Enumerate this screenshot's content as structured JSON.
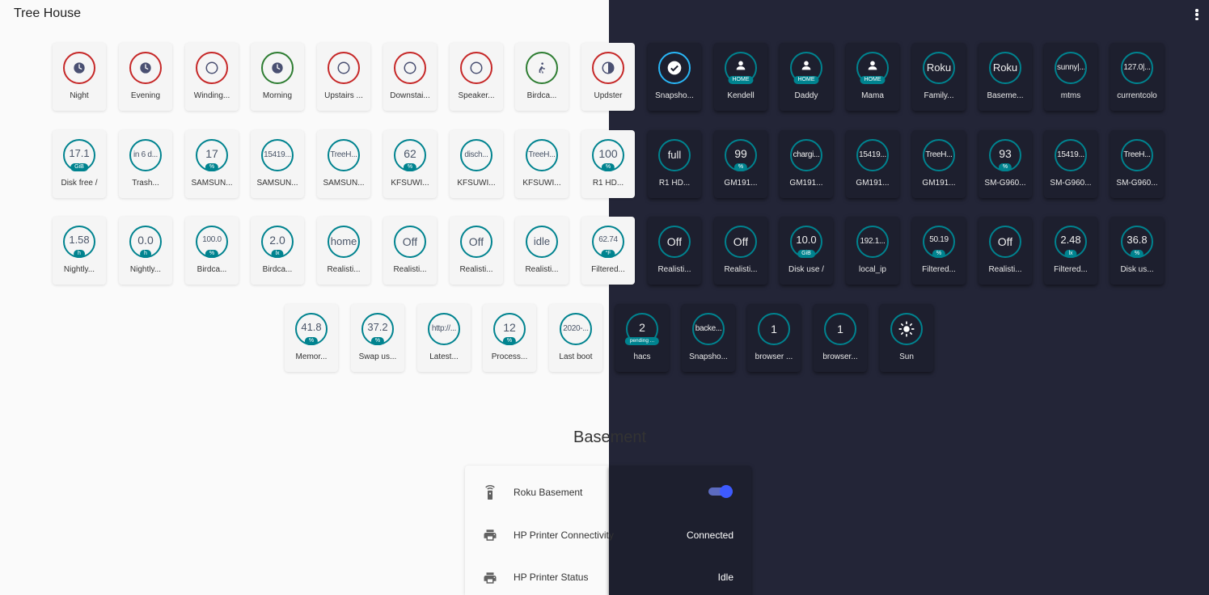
{
  "header": {
    "title": "Tree House",
    "menu_icon": "dots-vertical-icon"
  },
  "badges": [
    {
      "label": "Night",
      "ring": "red",
      "icon": "clock-icon"
    },
    {
      "label": "Evening",
      "ring": "red",
      "icon": "clock-icon"
    },
    {
      "label": "Winding...",
      "ring": "red",
      "icon": "circle-outline-icon"
    },
    {
      "label": "Morning",
      "ring": "green",
      "icon": "clock-icon"
    },
    {
      "label": "Upstairs ...",
      "ring": "red",
      "icon": "circle-outline-icon"
    },
    {
      "label": "Downstai...",
      "ring": "red",
      "icon": "circle-outline-icon"
    },
    {
      "label": "Speaker...",
      "ring": "red",
      "icon": "circle-outline-icon"
    },
    {
      "label": "Birdca...",
      "ring": "green",
      "icon": "walk-icon"
    },
    {
      "label": "Updster",
      "ring": "red",
      "icon": "contrast-circle-icon"
    },
    {
      "label": "Snapsho...",
      "ring": "blue",
      "icon": "check-circle-icon"
    },
    {
      "label": "Kendell",
      "ring": "teal",
      "icon": "person-icon",
      "unit": "HOME"
    },
    {
      "label": "Daddy",
      "ring": "teal",
      "icon": "person-icon",
      "unit": "HOME"
    },
    {
      "label": "Mama",
      "ring": "teal",
      "icon": "person-icon",
      "unit": "HOME"
    },
    {
      "label": "Family...",
      "ring": "teal",
      "value": "Roku"
    },
    {
      "label": "Baseme...",
      "ring": "teal",
      "value": "Roku"
    },
    {
      "label": "mtms",
      "ring": "teal",
      "value": "sunny|..."
    },
    {
      "label": "currentcolo",
      "ring": "teal",
      "value": "127.0|..."
    },
    {
      "label": "Disk free /",
      "ring": "teal",
      "value": "17.1",
      "unit": "GiB"
    },
    {
      "label": "Trash...",
      "ring": "teal",
      "value": "in 6 d..."
    },
    {
      "label": "SAMSUN...",
      "ring": "teal",
      "value": "17",
      "unit": "%"
    },
    {
      "label": "SAMSUN...",
      "ring": "teal",
      "value": "15419..."
    },
    {
      "label": "SAMSUN...",
      "ring": "teal",
      "value": "TreeH..."
    },
    {
      "label": "KFSUWI...",
      "ring": "teal",
      "value": "62",
      "unit": "%"
    },
    {
      "label": "KFSUWI...",
      "ring": "teal",
      "value": "disch..."
    },
    {
      "label": "KFSUWI...",
      "ring": "teal",
      "value": "TreeH..."
    },
    {
      "label": "R1 HD...",
      "ring": "teal",
      "value": "100",
      "unit": "%"
    },
    {
      "label": "R1 HD...",
      "ring": "teal",
      "value": "full"
    },
    {
      "label": "GM191...",
      "ring": "teal",
      "value": "99",
      "unit": "%"
    },
    {
      "label": "GM191...",
      "ring": "teal",
      "value": "chargi..."
    },
    {
      "label": "GM191...",
      "ring": "teal",
      "value": "15419..."
    },
    {
      "label": "GM191...",
      "ring": "teal",
      "value": "TreeH..."
    },
    {
      "label": "SM-G960...",
      "ring": "teal",
      "value": "93",
      "unit": "%"
    },
    {
      "label": "SM-G960...",
      "ring": "teal",
      "value": "15419..."
    },
    {
      "label": "SM-G960...",
      "ring": "teal",
      "value": "TreeH..."
    },
    {
      "label": "Nightly...",
      "ring": "teal",
      "value": "1.58",
      "unit": "h"
    },
    {
      "label": "Nightly...",
      "ring": "teal",
      "value": "0.0",
      "unit": "h"
    },
    {
      "label": "Birdca...",
      "ring": "teal",
      "value": "100.0",
      "unit": "%"
    },
    {
      "label": "Birdca...",
      "ring": "teal",
      "value": "2.0",
      "unit": "lx"
    },
    {
      "label": "Realisti...",
      "ring": "teal",
      "value": "home"
    },
    {
      "label": "Realisti...",
      "ring": "teal",
      "value": "Off"
    },
    {
      "label": "Realisti...",
      "ring": "teal",
      "value": "Off"
    },
    {
      "label": "Realisti...",
      "ring": "teal",
      "value": "idle"
    },
    {
      "label": "Filtered...",
      "ring": "teal",
      "value": "62.74",
      "unit": "°F"
    },
    {
      "label": "Realisti...",
      "ring": "teal",
      "value": "Off"
    },
    {
      "label": "Realisti...",
      "ring": "teal",
      "value": "Off"
    },
    {
      "label": "Disk use /",
      "ring": "teal",
      "value": "10.0",
      "unit": "GiB"
    },
    {
      "label": "local_ip",
      "ring": "teal",
      "value": "192.1..."
    },
    {
      "label": "Filtered...",
      "ring": "teal",
      "value": "50.19",
      "unit": "%"
    },
    {
      "label": "Realisti...",
      "ring": "teal",
      "value": "Off"
    },
    {
      "label": "Filtered...",
      "ring": "teal",
      "value": "2.48",
      "unit": "lx"
    },
    {
      "label": "Disk us...",
      "ring": "teal",
      "value": "36.8",
      "unit": "%"
    },
    {
      "label": "Memor...",
      "ring": "teal",
      "value": "41.8",
      "unit": "%"
    },
    {
      "label": "Swap us...",
      "ring": "teal",
      "value": "37.2",
      "unit": "%"
    },
    {
      "label": "Latest...",
      "ring": "teal",
      "value": "http://..."
    },
    {
      "label": "Process...",
      "ring": "teal",
      "value": "12",
      "unit": "%"
    },
    {
      "label": "Last boot",
      "ring": "teal",
      "value": "2020-..."
    },
    {
      "label": "hacs",
      "ring": "teal",
      "value": "2",
      "unit": "pending ..."
    },
    {
      "label": "Snapsho...",
      "ring": "teal",
      "value": "backe..."
    },
    {
      "label": "browser ...",
      "ring": "teal",
      "value": "1"
    },
    {
      "label": "browser...",
      "ring": "teal",
      "value": "1"
    },
    {
      "label": "Sun",
      "ring": "teal",
      "icon": "sun-icon"
    }
  ],
  "section": {
    "title": "Basement",
    "rows": [
      {
        "icon": "remote-icon",
        "name": "Roku Basement",
        "toggle_on": true
      },
      {
        "icon": "printer-icon",
        "name": "HP Printer Connectivity",
        "value": "Connected"
      },
      {
        "icon": "printer-icon",
        "name": "HP Printer Status",
        "value": "Idle"
      }
    ]
  }
}
